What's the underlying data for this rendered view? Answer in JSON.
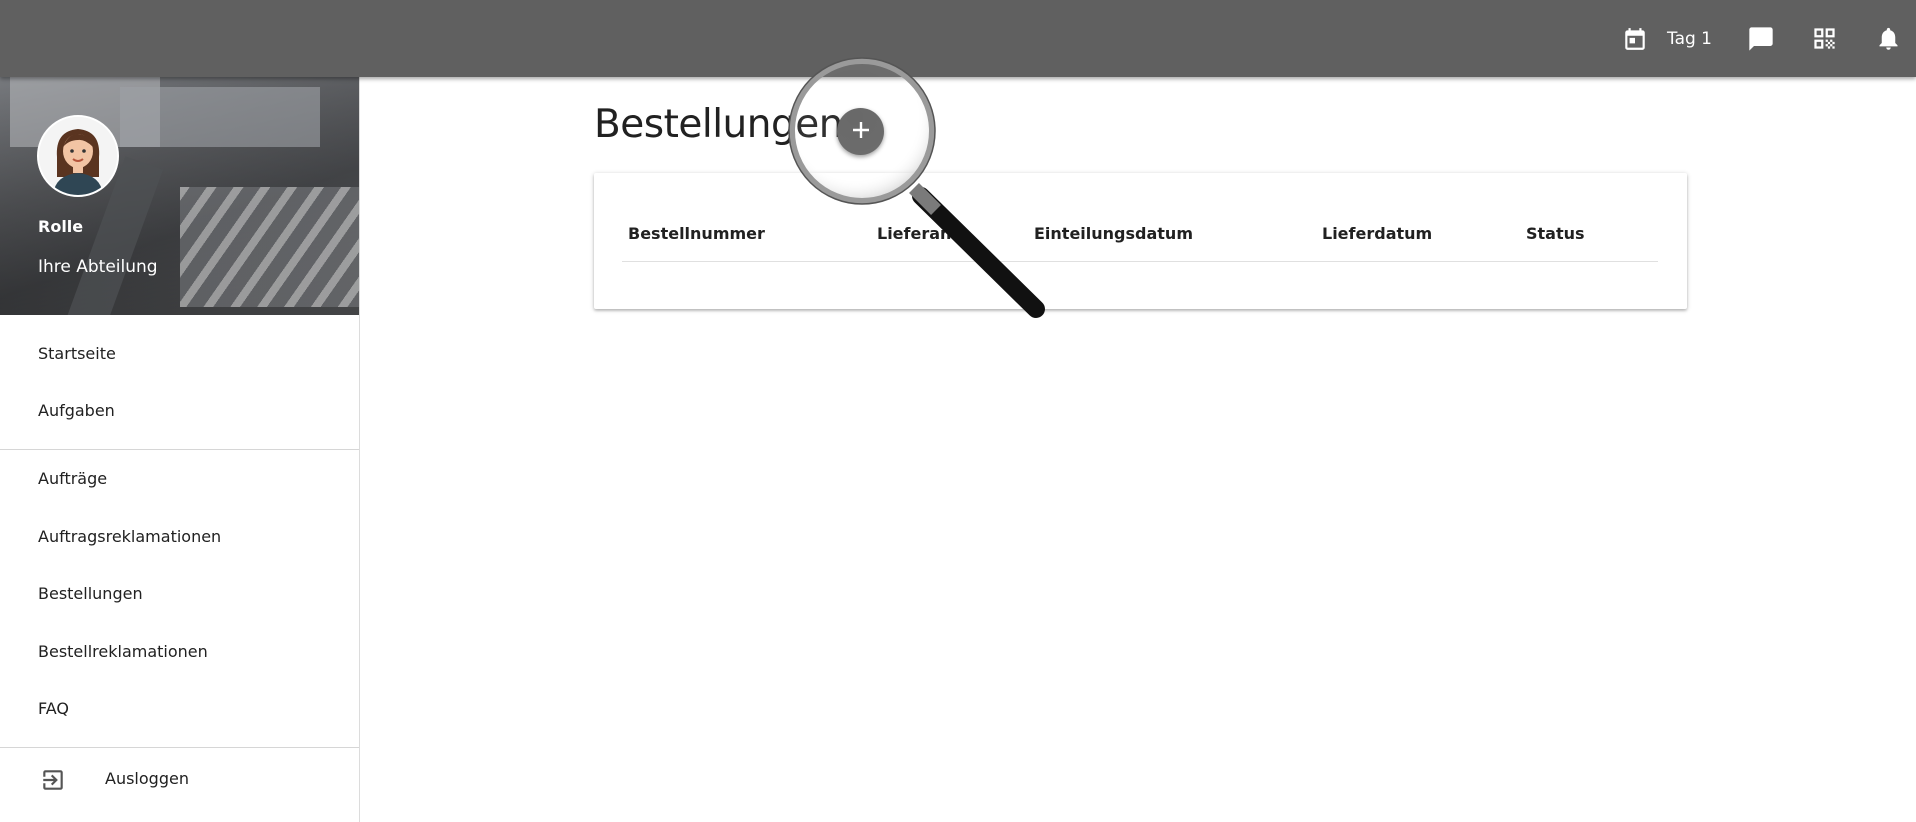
{
  "topbar": {
    "day_label": "Tag 1",
    "icons": [
      "calendar-icon",
      "chat-icon",
      "qr-code-icon",
      "bell-icon"
    ],
    "background": "#606060"
  },
  "sidebar": {
    "role": "Rolle",
    "department": "Ihre Abteilung",
    "items": [
      {
        "label": "Startseite"
      },
      {
        "label": "Aufgaben"
      },
      {
        "label": "Aufträge"
      },
      {
        "label": "Auftragsreklamationen"
      },
      {
        "label": "Bestellungen"
      },
      {
        "label": "Bestellreklamationen"
      },
      {
        "label": "FAQ"
      }
    ],
    "logout_label": "Ausloggen"
  },
  "main": {
    "title": "Bestellungen",
    "add_button_icon": "plus-icon",
    "table": {
      "columns": [
        "Bestellnummer",
        "Lieferant",
        "Einteilungsdatum",
        "Lieferdatum",
        "Status"
      ],
      "rows": []
    }
  }
}
